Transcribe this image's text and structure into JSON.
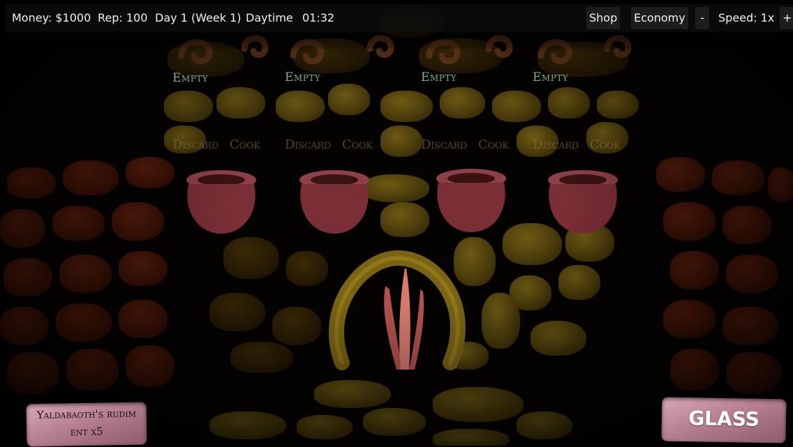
{
  "hud": {
    "money": "Money: $1000",
    "rep": "Rep: 100",
    "day": "Day 1 (Week 1)",
    "phase": "Daytime",
    "clock": "01:32",
    "shop_label": "Shop",
    "economy_label": "Economy",
    "speed_minus": "-",
    "speed_label": "Speed: 1x",
    "speed_plus": "+"
  },
  "cauldrons": [
    {
      "status": "Empty",
      "discard": "Discard",
      "cook": "Cook"
    },
    {
      "status": "Empty",
      "discard": "Discard",
      "cook": "Cook"
    },
    {
      "status": "Empty",
      "discard": "Discard",
      "cook": "Cook"
    },
    {
      "status": "Empty",
      "discard": "Discard",
      "cook": "Cook"
    }
  ],
  "ingredient_card": {
    "line1": "Yaldabaoth's rudim",
    "line2": "ent x5"
  },
  "glass_button": {
    "label": "GLASS"
  },
  "colors": {
    "hud_bg": "#121212",
    "status_text": "#7fb27f",
    "action_text": "#96784680",
    "card_pink": "#c48fa2",
    "stone_yellow": "#5a4a10",
    "stone_red": "#4a1809"
  }
}
